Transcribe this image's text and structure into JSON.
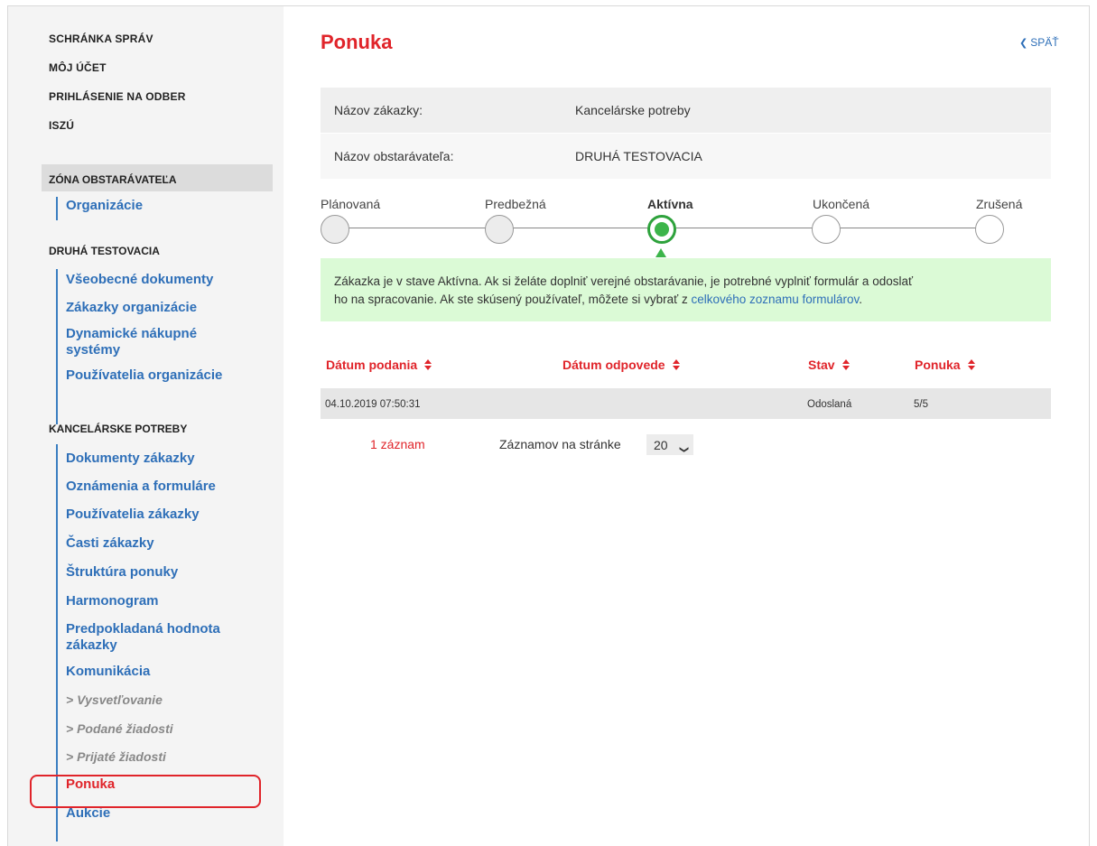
{
  "sidebar": {
    "top_links": [
      "SCHRÁNKA SPRÁV",
      "MÔJ ÚČET",
      "PRIHLÁSENIE NA ODBER",
      "ISZÚ"
    ],
    "zone_header": "ZÓNA OBSTARÁVATEĽA",
    "zone_items": [
      "Organizácie"
    ],
    "org_title": "DRUHÁ TESTOVACIA",
    "org_items": [
      "Všeobecné dokumenty",
      "Zákazky organizácie",
      "Dynamické nákupné systémy",
      "Používatelia organizácie"
    ],
    "contract_title": "KANCELÁRSKE POTREBY",
    "contract_items": [
      "Dokumenty zákazky",
      "Oznámenia a formuláre",
      "Používatelia zákazky",
      "Časti zákazky",
      "Štruktúra ponuky",
      "Harmonogram",
      "Predpokladaná hodnota zákazky",
      "Komunikácia"
    ],
    "comm_subitems": [
      "> Vysvetľovanie",
      "> Podané žiadosti",
      "> Prijaté žiadosti"
    ],
    "active_item": "Ponuka",
    "last_item": "Aukcie"
  },
  "header": {
    "title": "Ponuka",
    "back_label": "SPÄŤ"
  },
  "info": {
    "contract_label": "Názov zákazky:",
    "contract_value": "Kancelárske potreby",
    "buyer_label": "Názov obstarávateľa:",
    "buyer_value": "DRUHÁ TESTOVACIA"
  },
  "stepper": {
    "steps": [
      "Plánovaná",
      "Predbežná",
      "Aktívna",
      "Ukončená",
      "Zrušená"
    ],
    "active_index": 2,
    "accent_color": "#3cb54a"
  },
  "notice": {
    "text_line1": "Zákazka je v stave Aktívna. Ak si želáte doplniť verejné obstarávanie, je potrebné vyplniť formulár a odoslať",
    "text_line2_prefix": "ho na spracovanie. Ak ste skúsený používateľ, môžete si vybrať z ",
    "link": "celkového zoznamu formulárov",
    "text_line2_suffix": "."
  },
  "table": {
    "columns": [
      "Dátum podania",
      "Dátum odpovede",
      "Stav",
      "Ponuka"
    ],
    "rows": [
      {
        "submitted": "04.10.2019 07:50:31",
        "response": "",
        "status": "Odoslaná",
        "offer": "5/5"
      }
    ]
  },
  "pagination": {
    "count": "1 záznam",
    "per_page_label": "Záznamov na stránke",
    "per_page_value": "20"
  },
  "colors": {
    "brand_red": "#e0242a",
    "link_blue": "#2e6fb8",
    "notice_green": "#dbfad6"
  }
}
